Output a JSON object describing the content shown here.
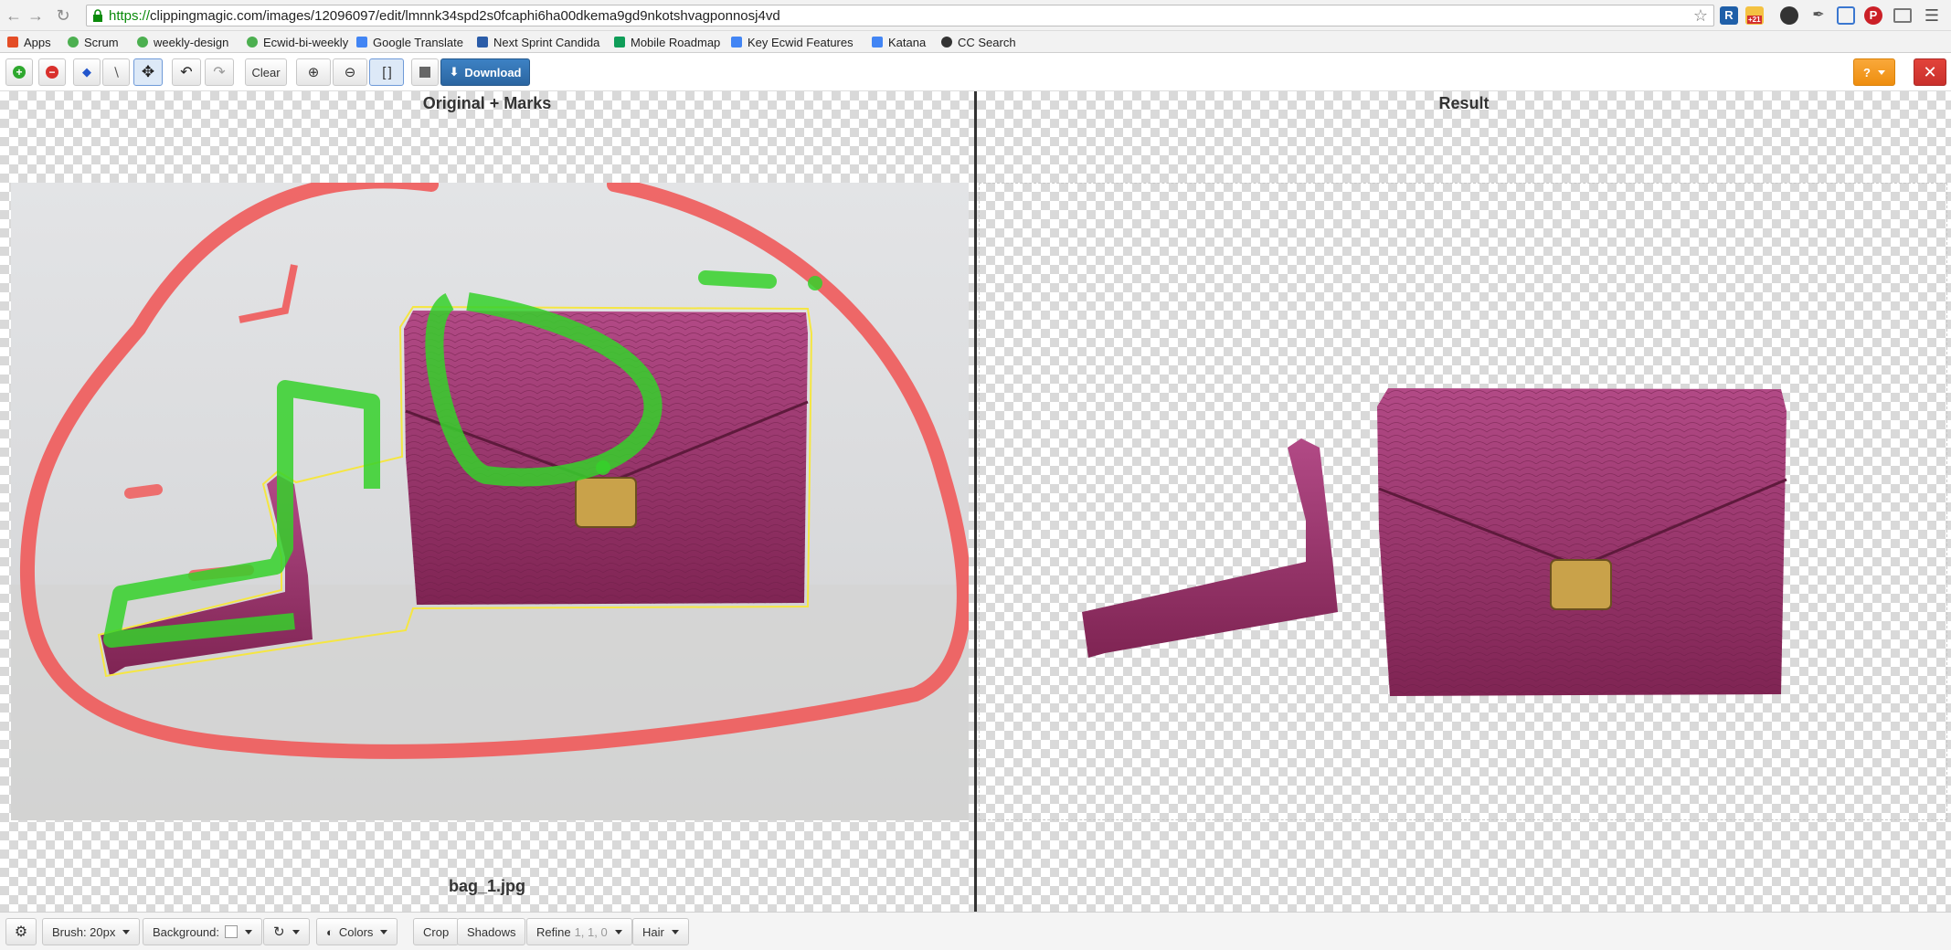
{
  "browser": {
    "url_scheme": "https://",
    "url_rest": "clippingmagic.com/images/12096097/edit/lmnnk34spd2s0fcaphi6ha00dkema9gd9nkotshvagponnosj4vd",
    "back_icon": "back-arrow-icon",
    "forward_icon": "forward-arrow-icon",
    "reload_icon": "reload-icon",
    "extensions": [
      {
        "name": "r-extension-icon",
        "label": "R",
        "color": "#1f5fa8"
      },
      {
        "name": "weather-extension-icon",
        "label": "",
        "badge": "+21",
        "color": "#f4c242"
      },
      {
        "name": "camera-extension-icon",
        "label": "",
        "color": "#333333"
      },
      {
        "name": "eyedropper-extension-icon",
        "label": "",
        "color": "#666666"
      },
      {
        "name": "screenshot-extension-icon",
        "label": "",
        "color": "#3a77d0"
      },
      {
        "name": "pinterest-extension-icon",
        "label": "P",
        "color": "#cb2027"
      },
      {
        "name": "cast-icon",
        "label": "",
        "color": "#666666"
      },
      {
        "name": "menu-icon",
        "label": "",
        "color": "#666666"
      }
    ]
  },
  "bookmarks": [
    {
      "label": "Apps",
      "icon": "apps-grid-icon",
      "color": "#e44d26"
    },
    {
      "label": "Scrum",
      "icon": "leaf-icon",
      "color": "#4caf50"
    },
    {
      "label": "weekly-design",
      "icon": "leaf-icon",
      "color": "#4caf50"
    },
    {
      "label": "Ecwid-bi-weekly",
      "icon": "leaf-icon",
      "color": "#4caf50"
    },
    {
      "label": "Google Translate",
      "icon": "translate-icon",
      "color": "#4285f4"
    },
    {
      "label": "Next Sprint Candida",
      "icon": "jira-icon",
      "color": "#2a5ca8"
    },
    {
      "label": "Mobile Roadmap",
      "icon": "sheets-icon",
      "color": "#0f9d58"
    },
    {
      "label": "Key Ecwid Features",
      "icon": "google-icon",
      "color": "#4285f4"
    },
    {
      "label": "Katana",
      "icon": "google-icon",
      "color": "#4285f4"
    },
    {
      "label": "CC Search",
      "icon": "cc-icon",
      "color": "#333333"
    }
  ],
  "toolbar": {
    "add_icon": "plus-icon",
    "remove_icon": "minus-icon",
    "hair_icon": "diamond-icon",
    "scalpel_icon": "scalpel-icon",
    "pan_icon": "move-icon",
    "undo_icon": "undo-icon",
    "redo_icon": "redo-icon",
    "clear_label": "Clear",
    "zoom_in_icon": "zoom-in-icon",
    "zoom_out_icon": "zoom-out-icon",
    "fit_icon": "fit-screen-icon",
    "save_icon": "save-icon",
    "download_label": "Download",
    "help_label": "?",
    "close_label": "✕"
  },
  "left_pane": {
    "title": "Original + Marks",
    "file_name": "bag_1.jpg"
  },
  "right_pane": {
    "title": "Result"
  },
  "bottom_toolbar": {
    "settings_icon": "gear-icon",
    "brush_label": "Brush: 20px",
    "background_label": "Background:",
    "rotate_icon": "rotate-icon",
    "colors_label": "Colors",
    "crop_label": "Crop",
    "shadows_label": "Shadows",
    "refine_label": "Refine",
    "refine_values": "1, 1, 0",
    "hair_label": "Hair"
  },
  "colors": {
    "keep_mark": "#35d12a",
    "remove_mark": "#f05a5a",
    "bag": "#9c3168",
    "accent": "#2b66a1"
  }
}
